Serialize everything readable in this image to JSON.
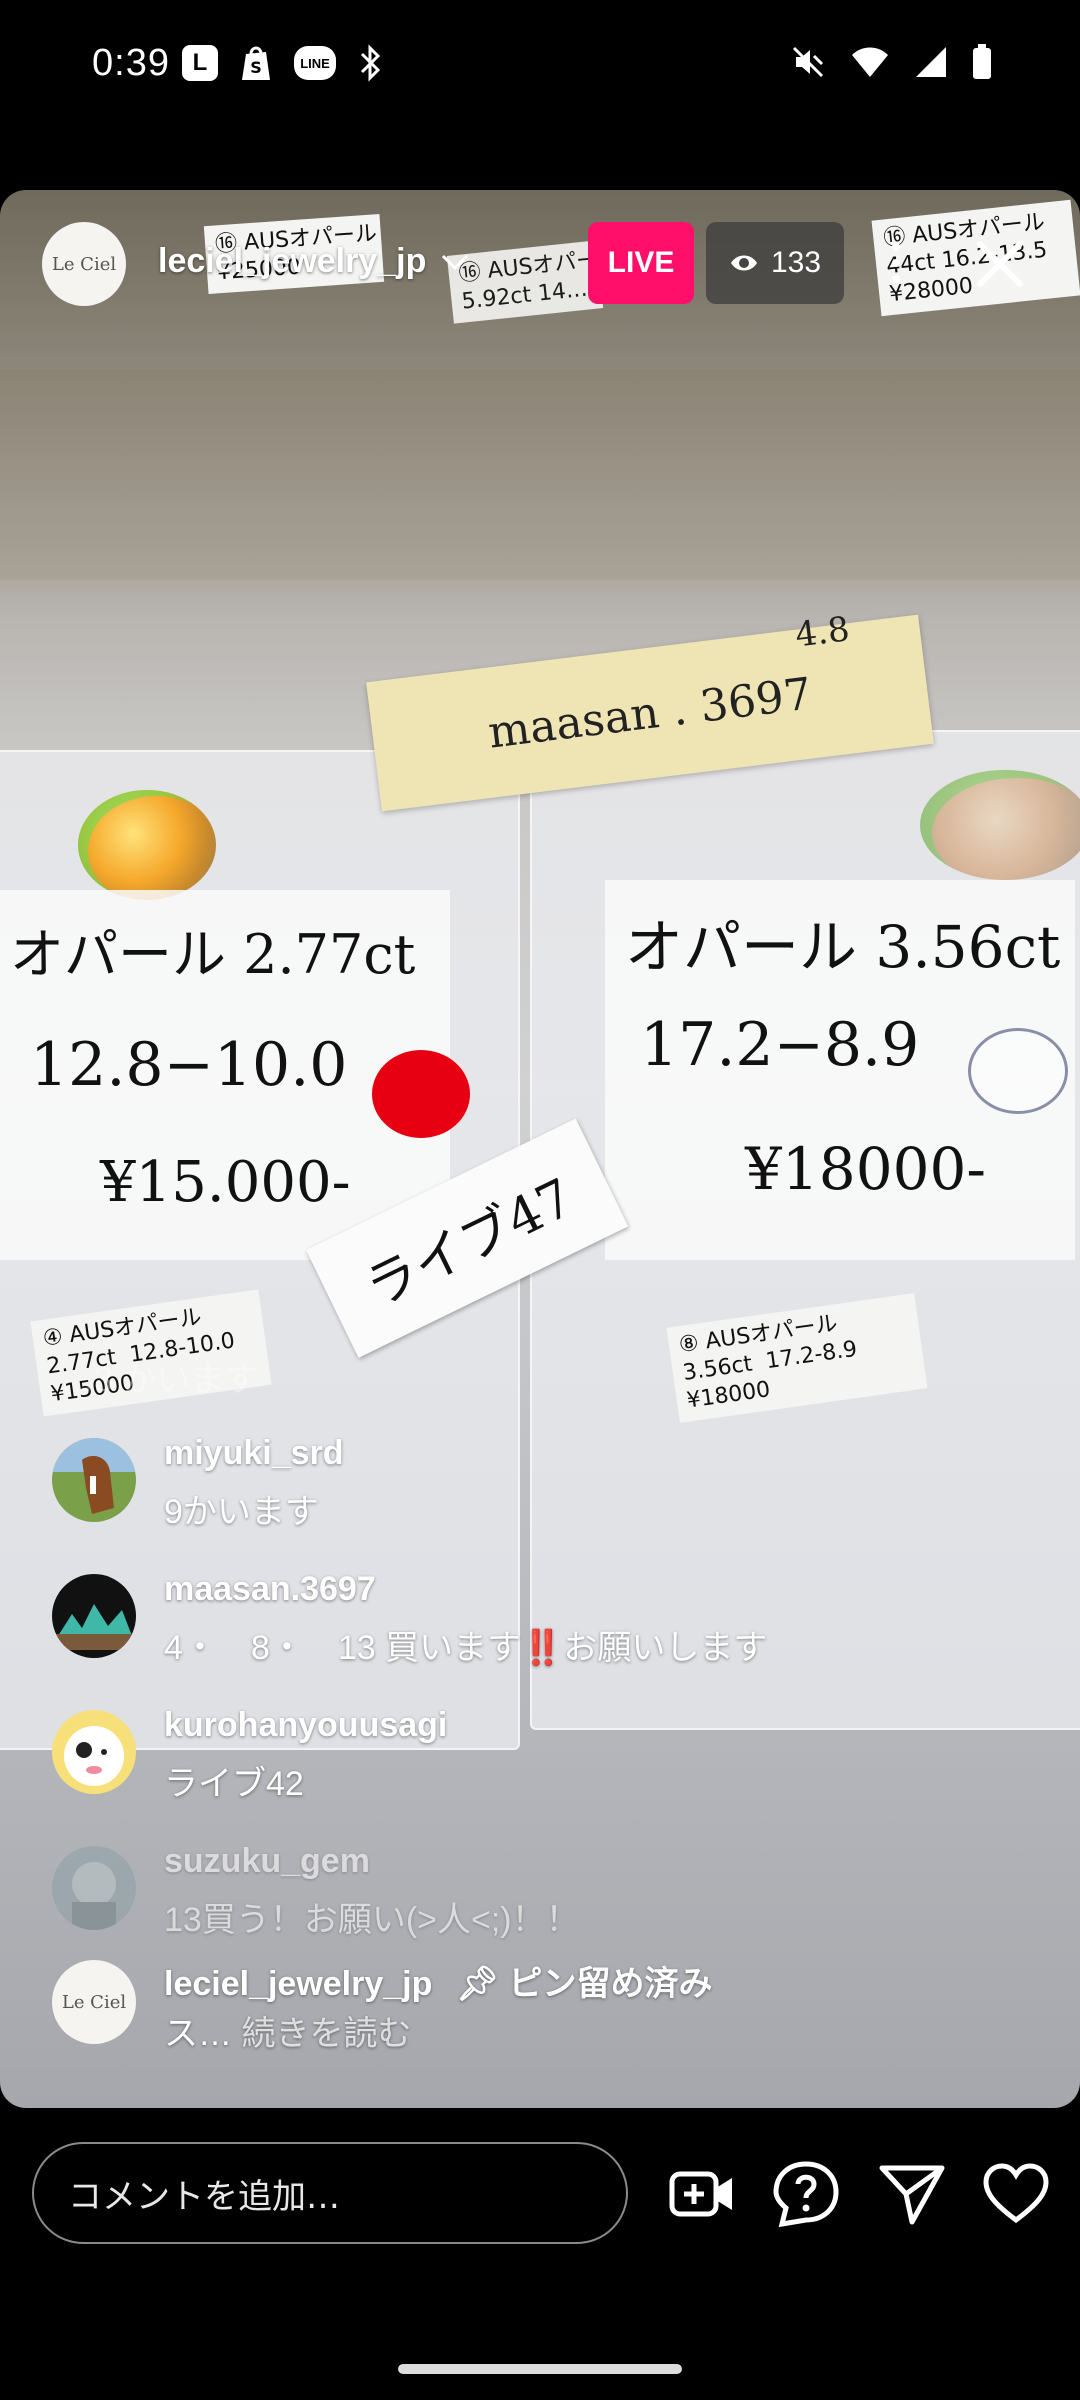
{
  "status_bar": {
    "time": "0:39",
    "left_icons": [
      "l-app-icon",
      "shopify-icon",
      "line-icon",
      "bluetooth-icon"
    ],
    "right_icons": [
      "mute-icon",
      "wifi-icon",
      "signal-icon",
      "battery-icon"
    ],
    "line_label": "LINE",
    "l_label": "L"
  },
  "header": {
    "avatar_text": "Le Ciel",
    "username": "leciel_jewelry_jp",
    "live_label": "LIVE",
    "viewer_count": "133"
  },
  "video": {
    "top_tags": [
      "⑯ AUSオパール\n¥25000",
      "⑯ AUSオパール\n5.92ct 14.…",
      "⑯ AUSオパール\n44ct 16.2-13.5\n¥28000"
    ],
    "note": "maasan . 3697",
    "note_superscript": "4.8",
    "left_card": {
      "line1": "オパール  2.77ct",
      "line2": "12.8−10.0",
      "line3": "¥15.000-"
    },
    "right_card": {
      "line1": "オパール  3.56ct",
      "line2": "17.2−8.9",
      "line3": "¥18000-"
    },
    "live_card": "ライブ47",
    "left_tag": "④ AUSオパール\n2.77ct  12.8-10.0\n¥15000",
    "right_tag": "⑧ AUSオパール\n3.56ct  17.2-8.9\n¥18000",
    "accent_colors": {
      "red_sticker": "#e60012",
      "live_pink": "#ff0f6a"
    }
  },
  "comments": {
    "ghost_text": "…3 かいます",
    "items": [
      {
        "user": "miyuki_srd",
        "text": "9かいます"
      },
      {
        "user": "maasan.3697",
        "text": "4・　8・　13  買います‼️お願いします"
      },
      {
        "user": "kurohanyouusagi",
        "text": "ライブ42"
      },
      {
        "user": "suzuku_gem",
        "text": "13買う！お願い(>人<;)！！"
      }
    ],
    "pinned": {
      "user": "leciel_jewelry_jp",
      "pin_label": "ピン留め済み",
      "text_prefix": "ス…",
      "more_label": "続きを読む"
    }
  },
  "bottom_bar": {
    "comment_placeholder": "コメントを追加…",
    "icons": [
      "add-video-icon",
      "question-icon",
      "send-icon",
      "heart-icon"
    ]
  }
}
